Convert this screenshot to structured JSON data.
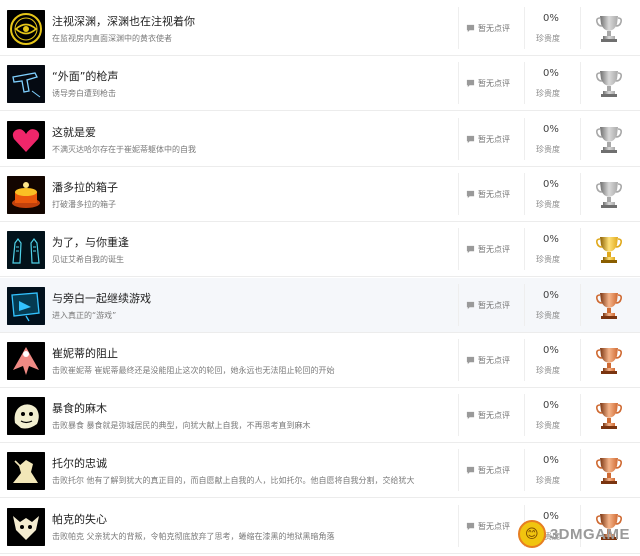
{
  "achievements": [
    {
      "title": "注视深渊，深渊也在注视着你",
      "description": "在监视房内直面深渊中的黄衣使者",
      "comment": "暂无点评",
      "percent": "0%",
      "rarity_label": "珍贵度",
      "trophy": "silver",
      "icon": "eye-icon",
      "highlight": false
    },
    {
      "title": "“外面”的枪声",
      "description": "诱导旁白遭到枪击",
      "comment": "暂无点评",
      "percent": "0%",
      "rarity_label": "珍贵度",
      "trophy": "silver",
      "icon": "gun-icon",
      "highlight": false
    },
    {
      "title": "这就是爱",
      "description": "不满灭达哈尔存在于崔妮蒂躯体中的自我",
      "comment": "暂无点评",
      "percent": "0%",
      "rarity_label": "珍贵度",
      "trophy": "silver",
      "icon": "heart-icon",
      "highlight": false
    },
    {
      "title": "潘多拉的箱子",
      "description": "打破潘多拉的箱子",
      "comment": "暂无点评",
      "percent": "0%",
      "rarity_label": "珍贵度",
      "trophy": "silver",
      "icon": "box-icon",
      "highlight": false
    },
    {
      "title": "为了，与你重逢",
      "description": "见证艾希自我的诞生",
      "comment": "暂无点评",
      "percent": "0%",
      "rarity_label": "珍贵度",
      "trophy": "gold",
      "icon": "hands-icon",
      "highlight": false
    },
    {
      "title": "与旁白一起继续游戏",
      "description": "进入真正的“游戏”",
      "comment": "暂无点评",
      "percent": "0%",
      "rarity_label": "珍贵度",
      "trophy": "bronze",
      "icon": "monitor-icon",
      "highlight": true
    },
    {
      "title": "崔妮蒂的阻止",
      "description": "击败崔妮蒂 崔妮蒂最终还是没能阻止这次的轮回，她永远也无法阻止轮回的开始",
      "comment": "暂无点评",
      "percent": "0%",
      "rarity_label": "珍贵度",
      "trophy": "bronze",
      "icon": "figure-icon",
      "highlight": false
    },
    {
      "title": "暴食的麻木",
      "description": "击败暴食 暴食就是弥城居民的典型，向犹大献上自我，不再思考直到麻木",
      "comment": "暂无点评",
      "percent": "0%",
      "rarity_label": "珍贵度",
      "trophy": "bronze",
      "icon": "creature-icon",
      "highlight": false
    },
    {
      "title": "托尔的忠诚",
      "description": "击败托尔 他有了解到犹大的真正目的，而自愿献上自我的人，比如托尔。他自愿将自我分割，交给犹大",
      "comment": "暂无点评",
      "percent": "0%",
      "rarity_label": "珍贵度",
      "trophy": "bronze",
      "icon": "knight-icon",
      "highlight": false
    },
    {
      "title": "帕克的失心",
      "description": "击败帕克 父亲犹大的背叛，令帕克彻底放弃了思考，蜷缩在漆黑的地狱黑暗角落",
      "comment": "暂无点评",
      "percent": "0%",
      "rarity_label": "珍贵度",
      "trophy": "bronze",
      "icon": "mask-icon",
      "highlight": false
    }
  ],
  "trophy_colors": {
    "silver": {
      "light": "#d9d9d9",
      "mid": "#a8a8a8",
      "dark": "#6f6f6f"
    },
    "gold": {
      "light": "#ffe27a",
      "mid": "#e0a91c",
      "dark": "#8a5e00"
    },
    "bronze": {
      "light": "#f5b48a",
      "mid": "#cf6a32",
      "dark": "#7a3410"
    }
  },
  "watermark": {
    "text": "3DMGAME",
    "emblem": "😊"
  }
}
